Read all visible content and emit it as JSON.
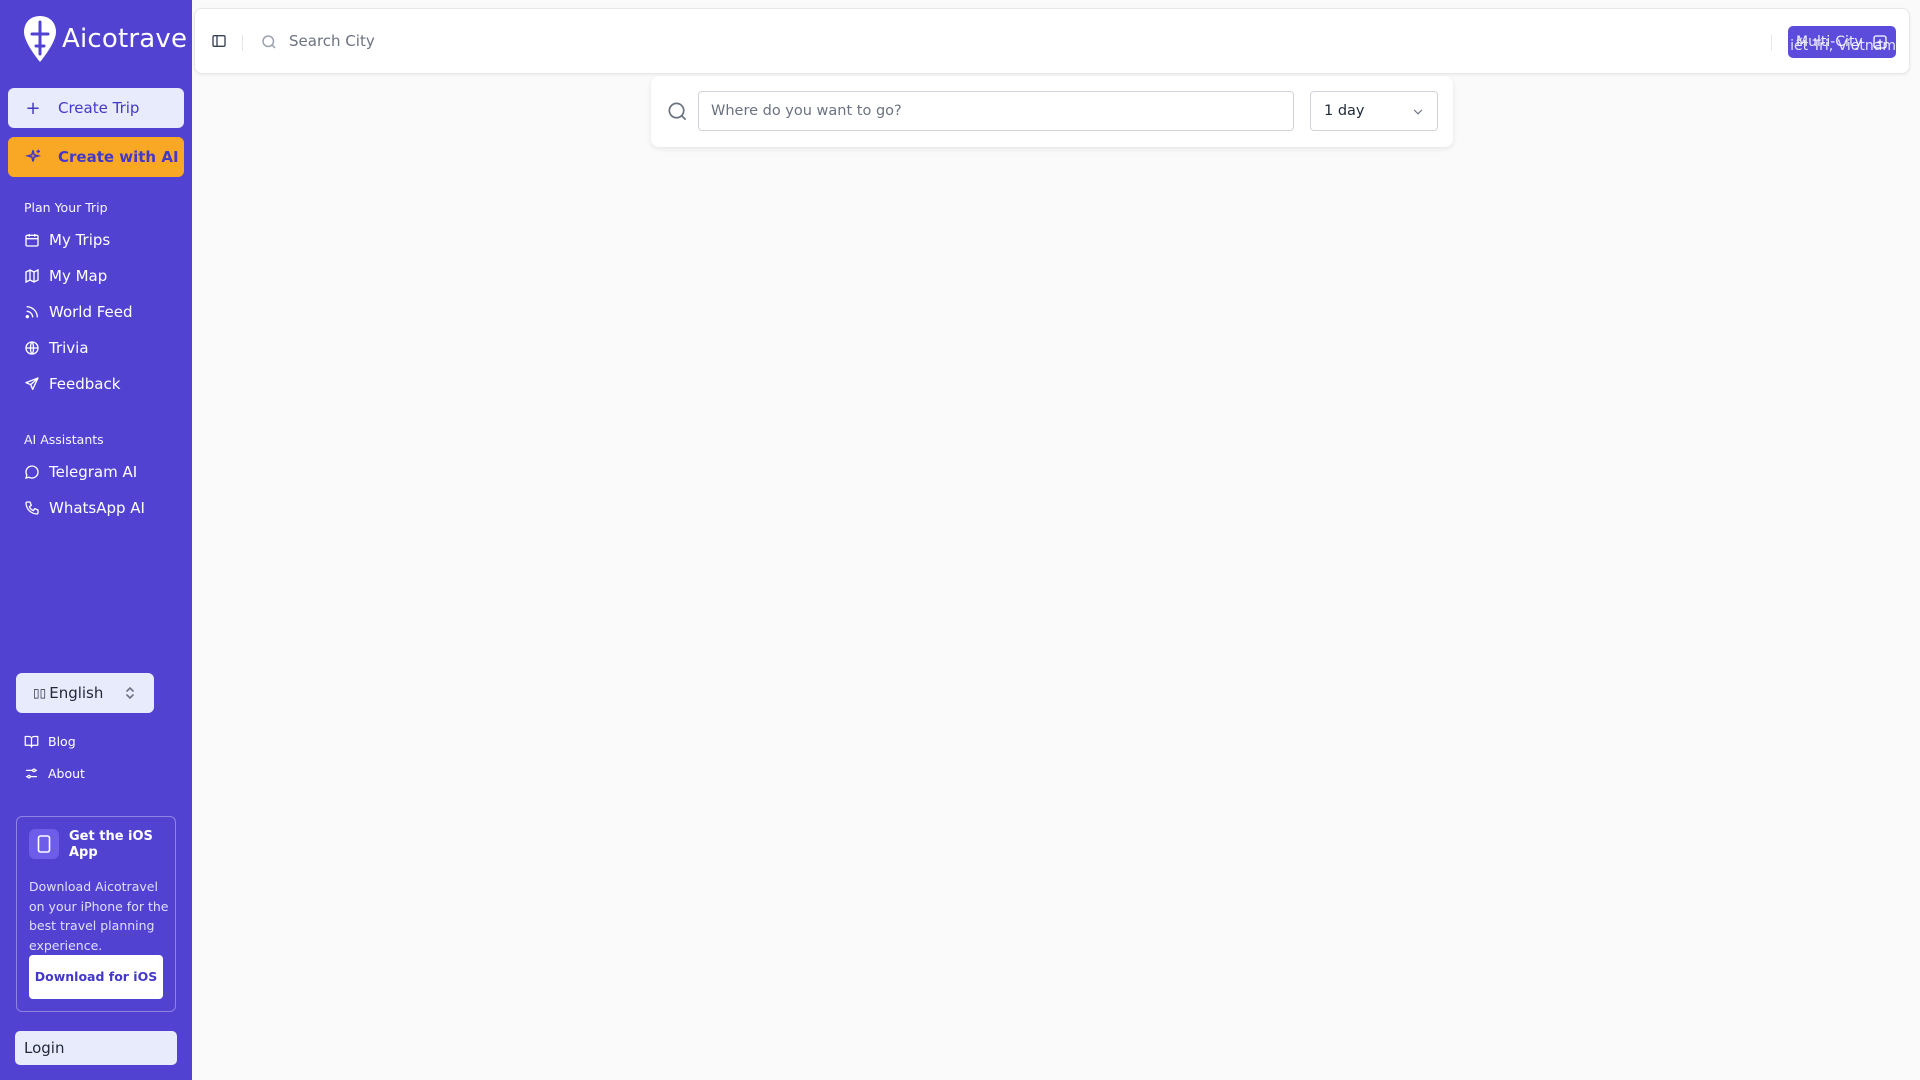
{
  "sidebar": {
    "brand": "Aicotrave",
    "create_trip": "Create Trip",
    "create_ai": "Create with AI",
    "plan_section": "Plan Your Trip",
    "plan_items": [
      "My Trips",
      "My Map",
      "World Feed",
      "Trivia",
      "Feedback"
    ],
    "ai_section": "AI Assistants",
    "ai_items": [
      "Telegram AI",
      "WhatsApp AI"
    ],
    "language": "English",
    "footer_links": [
      "Blog",
      "About"
    ],
    "ios_card": {
      "title": "Get the iOS App",
      "description": "Download Aicotravel on your iPhone for the best travel planning experience.",
      "button": "Download for iOS"
    },
    "login": "Login"
  },
  "header": {
    "search_placeholder": "Search City",
    "multi_city": "Multi-City",
    "city_overlay": "iết Tri, Vietnam"
  },
  "trip_search": {
    "placeholder": "Where do you want to go?",
    "duration": "1 day"
  },
  "colors": {
    "sidebar": "#5142d2",
    "accent": "#f9a825",
    "button_light": "#e8ebfb",
    "primary": "#5b4cdb"
  }
}
